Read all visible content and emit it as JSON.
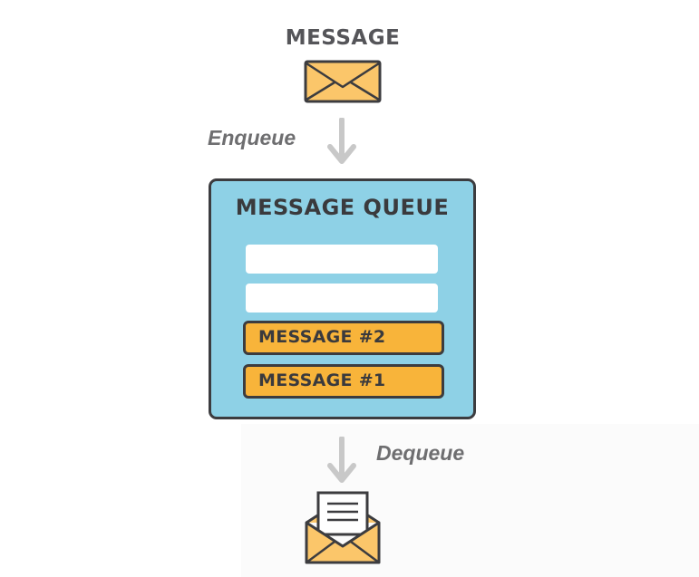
{
  "message_label": "MESSAGE",
  "enqueue_label": "Enqueue",
  "dequeue_label": "Dequeue",
  "queue": {
    "title": "MESSAGE QUEUE",
    "items": [
      "MESSAGE #2",
      "MESSAGE #1"
    ]
  },
  "icons": {
    "top": "envelope-icon",
    "bottom": "open-envelope-icon",
    "arrows": "arrow-down-icon"
  },
  "colors": {
    "queue_fill": "#8ed1e6",
    "message_fill": "#f8b43a",
    "envelope_fill": "#fbc66a",
    "outline": "#3c3c3f",
    "arrow": "#c8c8c8"
  }
}
